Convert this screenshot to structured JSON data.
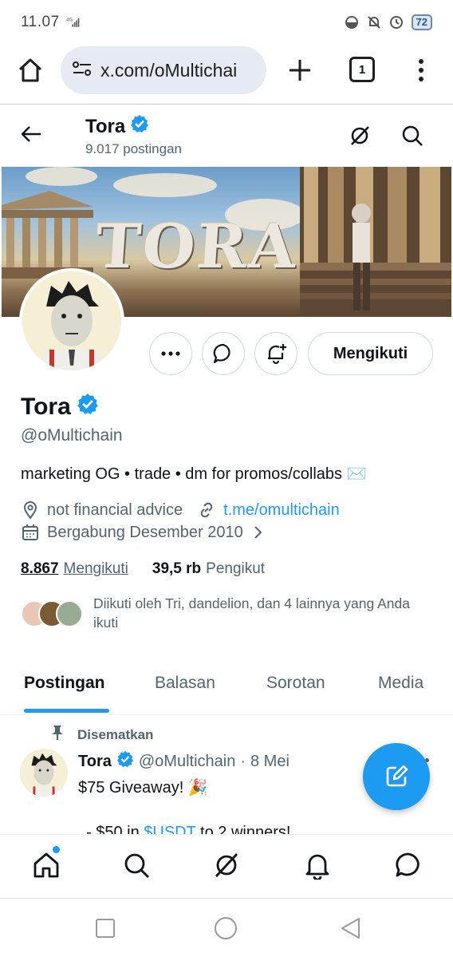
{
  "status_bar": {
    "time": "11.07",
    "network": "4G",
    "battery": "72"
  },
  "browser": {
    "url": "x.com/oMultichai",
    "tab_count": "1"
  },
  "profile_header": {
    "name": "Tora",
    "post_count": "9.017 postingan"
  },
  "banner": {
    "logo_text": "TORA"
  },
  "actions": {
    "follow_label": "Mengikuti"
  },
  "profile": {
    "name": "Tora",
    "handle": "@oMultichain",
    "bio": "marketing OG • trade • dm for promos/collabs ✉️",
    "location": "not financial advice",
    "link": "t.me/omultichain",
    "joined": "Bergabung Desember 2010"
  },
  "stats": {
    "following_count": "8.867",
    "following_label": "Mengikuti",
    "followers_count": "39,5 rb",
    "followers_label": "Pengikut"
  },
  "followed_by": {
    "text": "Diikuti oleh Tri, dandelion, dan 4 lainnya yang Anda ikuti"
  },
  "tabs": [
    "Postingan",
    "Balasan",
    "Sorotan",
    "Media"
  ],
  "post": {
    "pinned_label": "Disematkan",
    "author": "Tora",
    "handle": "@oMultichain",
    "separator": "·",
    "date": "8 Mei",
    "text": "$75 Giveaway! 🎉",
    "next_line_prefix": "- $50  in ",
    "next_line_cashtag": "$USDT",
    "next_line_suffix": " to 2 winners!"
  },
  "icons": {
    "home": "home-icon",
    "search": "search-icon",
    "grok": "grok-icon",
    "notifications": "bell-icon",
    "messages": "message-icon",
    "compose": "compose-icon"
  },
  "colors": {
    "accent": "#1d9bf0",
    "text": "#0f1419",
    "muted": "#536471"
  }
}
